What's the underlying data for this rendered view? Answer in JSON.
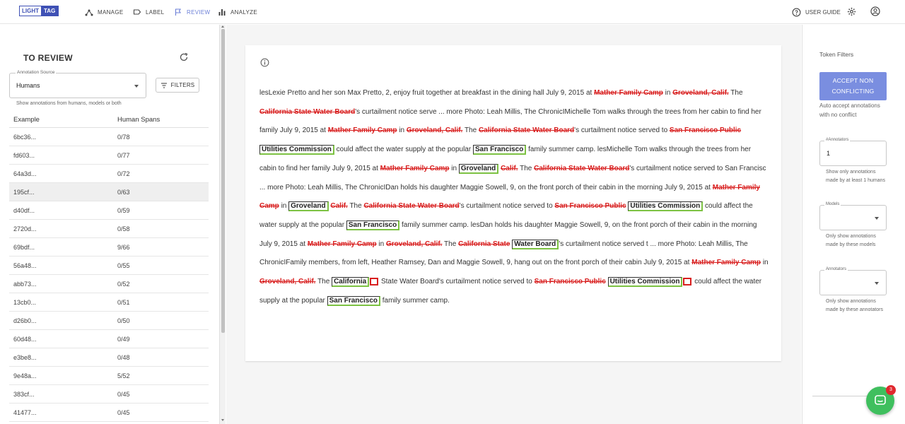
{
  "app": {
    "logo_part1": "LIGHT",
    "logo_part2": "TAG"
  },
  "nav": [
    {
      "label": "MANAGE",
      "icon": "graph-icon"
    },
    {
      "label": "LABEL",
      "icon": "label-icon"
    },
    {
      "label": "REVIEW",
      "icon": "flag-icon",
      "active": true
    },
    {
      "label": "ANALYZE",
      "icon": "bar-chart-icon"
    }
  ],
  "top_right": {
    "user_guide": "USER GUIDE"
  },
  "left": {
    "title": "TO REVIEW",
    "annotation_source_label": "Annotation Source",
    "annotation_source_value": "Humans",
    "filters_label": "FILTERS",
    "source_help": "Show annotations from humans, models or both",
    "col_example": "Example",
    "col_spans": "Human Spans",
    "rows": [
      {
        "example": "6bc36...",
        "spans": "0/78"
      },
      {
        "example": "fd603...",
        "spans": "0/77"
      },
      {
        "example": "64a3d...",
        "spans": "0/72"
      },
      {
        "example": "195cf...",
        "spans": "0/63"
      },
      {
        "example": "d40df...",
        "spans": "0/59"
      },
      {
        "example": "2720d...",
        "spans": "0/58"
      },
      {
        "example": "69bdf...",
        "spans": "9/66"
      },
      {
        "example": "56a48...",
        "spans": "0/55"
      },
      {
        "example": "abb73...",
        "spans": "0/52"
      },
      {
        "example": "13cb0...",
        "spans": "0/51"
      },
      {
        "example": "d26b0...",
        "spans": "0/50"
      },
      {
        "example": "60d48...",
        "spans": "0/49"
      },
      {
        "example": "e3be8...",
        "spans": "0/48"
      },
      {
        "example": "9e48a...",
        "spans": "5/52"
      },
      {
        "example": "383cf...",
        "spans": "0/45"
      },
      {
        "example": "41477...",
        "spans": "0/45"
      }
    ]
  },
  "doc": {
    "segments": [
      {
        "t": "n",
        "v": " lesLexie Pretto and her son Max Pretto, 2, enjoy fruit together at breakfast in the dining hall July 9, 2015 at "
      },
      {
        "t": "s",
        "v": "Mather Family Camp"
      },
      {
        "t": "n",
        "v": " in "
      },
      {
        "t": "s",
        "v": "Groveland, Calif."
      },
      {
        "t": "n",
        "v": " The "
      },
      {
        "t": "s",
        "v": "California State Water Board"
      },
      {
        "t": "n",
        "v": "'s curtailment notice serve ... more Photo: Leah Millis, The ChronicIMichelle Tom walks through the trees from her cabin to find her family July 9, 2015 at "
      },
      {
        "t": "s",
        "v": "Mather Family Camp"
      },
      {
        "t": "n",
        "v": " in "
      },
      {
        "t": "s",
        "v": "Groveland, Calif."
      },
      {
        "t": "n",
        "v": " The "
      },
      {
        "t": "s",
        "v": "California State Water Board"
      },
      {
        "t": "n",
        "v": "'s curtailment notice served to "
      },
      {
        "t": "s",
        "v": "San Francisco Public"
      },
      {
        "t": "n",
        "v": " "
      },
      {
        "t": "b",
        "v": "Utilities Commission"
      },
      {
        "t": "n",
        "v": " could affect the water supply at the popular "
      },
      {
        "t": "b",
        "v": "San Francisco"
      },
      {
        "t": "n",
        "v": " family summer camp.  lesMichelle Tom walks through the trees from her cabin to find her family July 9, 2015 at "
      },
      {
        "t": "s",
        "v": "Mather Family Camp"
      },
      {
        "t": "n",
        "v": " in "
      },
      {
        "t": "b",
        "v": "Groveland"
      },
      {
        "t": "n",
        "v": " "
      },
      {
        "t": "s",
        "v": "Calif."
      },
      {
        "t": "n",
        "v": " The "
      },
      {
        "t": "s",
        "v": "California State Water Board"
      },
      {
        "t": "n",
        "v": "'s curtailment notice served to San Francisc ... more Photo: Leah Millis, The ChronicIDan holds his daughter Maggie Sowell, 9, on the front porch of their cabin in the morning July 9, 2015 at "
      },
      {
        "t": "s",
        "v": "Mather Family Camp"
      },
      {
        "t": "n",
        "v": " in "
      },
      {
        "t": "b",
        "v": "Groveland"
      },
      {
        "t": "n",
        "v": " "
      },
      {
        "t": "s",
        "v": "Calif."
      },
      {
        "t": "n",
        "v": " The "
      },
      {
        "t": "s",
        "v": "California State Water Board"
      },
      {
        "t": "n",
        "v": "'s curtailment notice served to "
      },
      {
        "t": "s",
        "v": "San Francisco Public"
      },
      {
        "t": "n",
        "v": " "
      },
      {
        "t": "b",
        "v": "Utilities Commission"
      },
      {
        "t": "n",
        "v": " could affect the water supply at the popular "
      },
      {
        "t": "b",
        "v": "San Francisco"
      },
      {
        "t": "n",
        "v": " family summer camp.  lesDan holds his daughter Maggie Sowell, 9, on the front porch of their cabin in the morning July 9, 2015 at "
      },
      {
        "t": "s",
        "v": "Mather Family Camp"
      },
      {
        "t": "n",
        "v": " in "
      },
      {
        "t": "s",
        "v": "Groveland, Calif."
      },
      {
        "t": "n",
        "v": " The "
      },
      {
        "t": "s",
        "v": "California State"
      },
      {
        "t": "n",
        "v": " "
      },
      {
        "t": "b",
        "v": "Water Board"
      },
      {
        "t": "n",
        "v": "'s curtailment notice served t ... more Photo: Leah Millis, The ChronicIFamily members, from left, Heather Ramsey, Dan and Maggie Sowell, 9, hang out on the front porch of their cabin July 9, 2015 at "
      },
      {
        "t": "s",
        "v": "Mather Family Camp"
      },
      {
        "t": "n",
        "v": " in "
      },
      {
        "t": "s",
        "v": "Groveland, Calif."
      },
      {
        "t": "n",
        "v": " The "
      },
      {
        "t": "b",
        "v": "California"
      },
      {
        "t": "r",
        "v": ""
      },
      {
        "t": "n",
        "v": " State Water Board's curtailment notice served to "
      },
      {
        "t": "s",
        "v": "San Francisco Public"
      },
      {
        "t": "n",
        "v": " "
      },
      {
        "t": "b",
        "v": "Utilities Commission"
      },
      {
        "t": "r",
        "v": ""
      },
      {
        "t": "n",
        "v": " could affect the water supply at the popular "
      },
      {
        "t": "b",
        "v": "San Francisco"
      },
      {
        "t": "n",
        "v": " family summer camp."
      }
    ]
  },
  "right": {
    "token_filters": "Token Filters",
    "accept_line1": "ACCEPT NON",
    "accept_line2": "CONFLICTING",
    "auto_accept": "Auto accept annotations with no conflict",
    "annotators_count_label": "#Annotators",
    "annotators_count_value": "1",
    "annotators_help": "Show only annotations made by at least 1 humans",
    "models_label": "Models",
    "models_help": "Only show annotations made by these models",
    "annotators_label": "Annotators",
    "annotators_select_help": "Only show annotations made by these annotators"
  },
  "chat": {
    "badge": "3"
  },
  "colors": {
    "accent": "#3f51b5",
    "active_nav": "#6b7fd7",
    "strike_red": "#d81e1e",
    "box_green": "#7dc243",
    "accept_btn": "#7a8ee0",
    "chat_green": "#3fbf5e"
  }
}
